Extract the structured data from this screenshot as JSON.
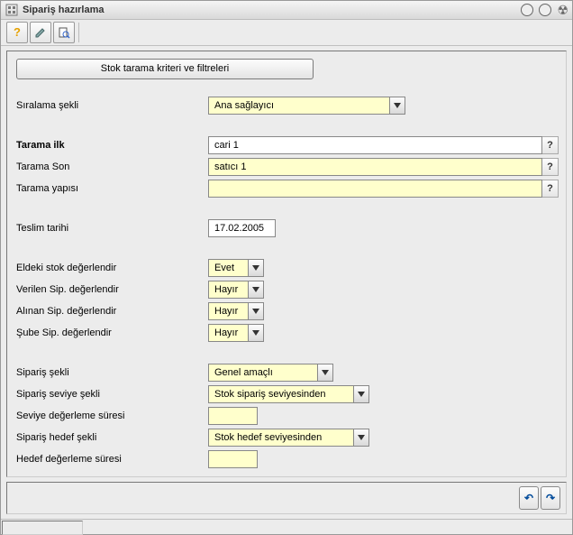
{
  "window": {
    "title": "Sipariş hazırlama"
  },
  "main_button": "Stok tarama kriteri ve filtreleri",
  "labels": {
    "siralama_sekli": "Sıralama şekli",
    "tarama_ilk": "Tarama ilk",
    "tarama_son": "Tarama Son",
    "tarama_yapisi": "Tarama yapısı",
    "teslim_tarihi": "Teslim tarihi",
    "eldeki_stok": "Eldeki stok değerlendir",
    "verilen_sip": "Verilen Sip. değerlendir",
    "alinan_sip": "Alınan Sip. değerlendir",
    "sube_sip": "Şube Sip. değerlendir",
    "siparis_sekli": "Sipariş şekli",
    "siparis_seviye_sekli": "Sipariş seviye şekli",
    "seviye_degerleme_suresi": "Seviye değerleme süresi",
    "siparis_hedef_sekli": "Sipariş hedef şekli",
    "hedef_degerleme_suresi": "Hedef değerleme süresi"
  },
  "values": {
    "siralama_sekli": "Ana sağlayıcı",
    "tarama_ilk": "cari 1",
    "tarama_son": "satıcı 1",
    "tarama_yapisi": "",
    "teslim_tarihi": "17.02.2005",
    "eldeki_stok": "Evet",
    "verilen_sip": "Hayır",
    "alinan_sip": "Hayır",
    "sube_sip": "Hayır",
    "siparis_sekli": "Genel amaçlı",
    "siparis_seviye_sekli": "Stok sipariş seviyesinden",
    "seviye_degerleme_suresi": "",
    "siparis_hedef_sekli": "Stok hedef seviyesinden",
    "hedef_degerleme_suresi": ""
  },
  "widths": {
    "siralama_sekli": 200,
    "teslim_tarihi": 75,
    "yesno": 43,
    "siparis_sekli": 120,
    "seviye_sekli": 160,
    "sure": 55
  },
  "help_glyph": "?",
  "nav": {
    "prev": "↶",
    "next": "↷"
  }
}
